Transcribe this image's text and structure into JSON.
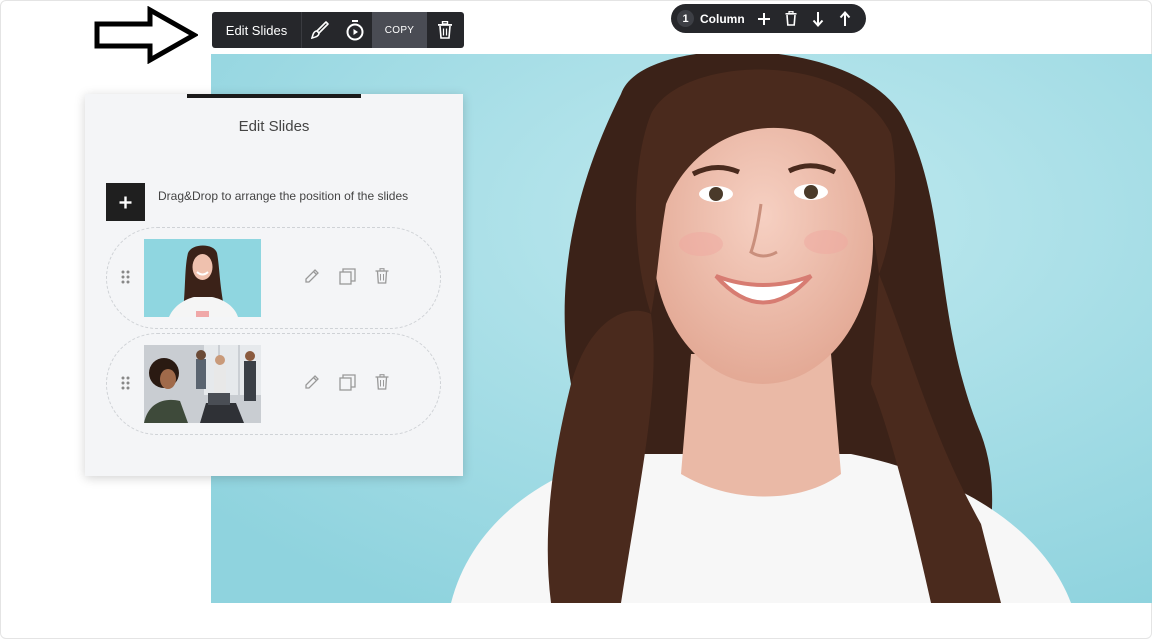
{
  "element_toolbar": {
    "edit_slides_label": "Edit Slides",
    "copy_label": "COPY"
  },
  "column_toolbar": {
    "count": "1",
    "label": "Column"
  },
  "panel": {
    "title": "Edit Slides",
    "hint": "Drag&Drop to arrange the position of the slides",
    "slides": [
      {
        "thumbnail": "woman-smiling-portrait"
      },
      {
        "thumbnail": "office-team-meeting"
      }
    ]
  },
  "icons": {
    "toolbar": [
      "brush-icon",
      "timer-icon",
      "trash-icon"
    ],
    "column": [
      "plus-icon",
      "trash-icon",
      "arrow-down-icon",
      "arrow-up-icon"
    ],
    "slide_actions": [
      "pencil-icon",
      "duplicate-icon",
      "trash-icon"
    ]
  },
  "colors": {
    "toolbar_bg": "#26272b",
    "hero_bg": "#a7dfe7",
    "panel_bg": "#f4f5f7"
  }
}
